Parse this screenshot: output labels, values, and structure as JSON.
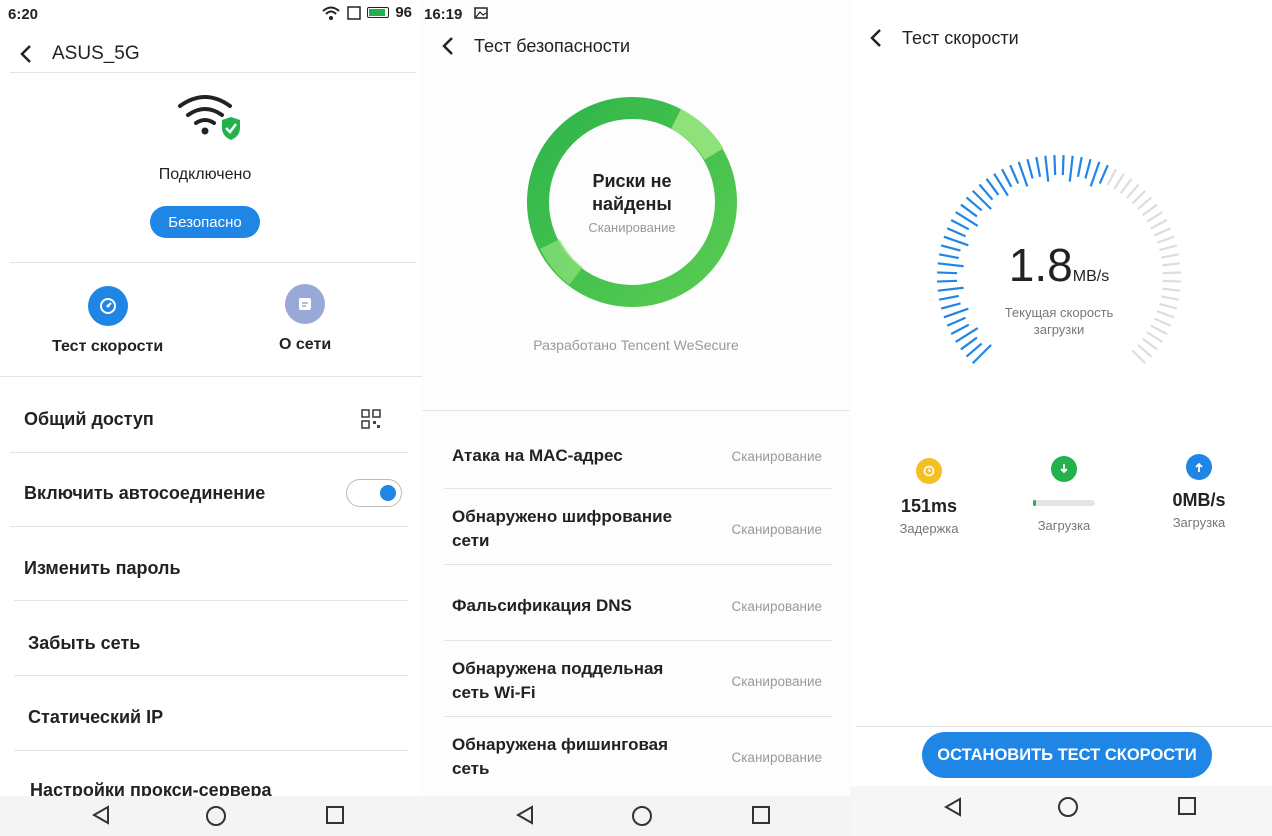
{
  "panel1": {
    "status": {
      "time": "6:20",
      "battery": "96"
    },
    "title": "ASUS_5G",
    "connected": "Подключено",
    "safe_badge": "Безопасно",
    "actions": {
      "speed_test": "Тест скорости",
      "about": "О сети"
    },
    "rows": {
      "share": "Общий доступ",
      "autoconnect": "Включить автосоединение",
      "change_password": "Изменить пароль",
      "forget": "Забыть сеть",
      "static_ip": "Статический IP",
      "proxy": "Настройки прокси-сервера"
    },
    "autoconnect_on": true,
    "colors": {
      "accent": "#1f86e6",
      "green": "#23b14d",
      "about_icon": "#9aa8d8"
    }
  },
  "panel2": {
    "status": {
      "time": "16:19"
    },
    "title": "Тест безопасности",
    "ring_title": "Риски не найдены",
    "ring_sub": "Сканирование",
    "developer": "Разработано Tencent WeSecure",
    "risks": [
      {
        "name": "Атака на MAC-адрес",
        "status": "Сканирование"
      },
      {
        "name": "Обнаружено шифрование сети",
        "status": "Сканирование"
      },
      {
        "name": "Фальсификация DNS",
        "status": "Сканирование"
      },
      {
        "name": "Обнаружена поддельная сеть Wi-Fi",
        "status": "Сканирование"
      },
      {
        "name": "Обнаружена фишинговая сеть",
        "status": "Сканирование"
      }
    ]
  },
  "panel3": {
    "title": "Тест скорости",
    "speed_value": "1.8",
    "speed_unit": "MB/s",
    "speed_caption": "Текущая скорость загрузки",
    "gauge_fraction": 0.6,
    "stats": {
      "latency": {
        "value": "151ms",
        "label": "Задержка"
      },
      "download": {
        "label": "Загрузка",
        "progress": 0.05
      },
      "upload": {
        "value": "0MB/s",
        "label": "Загрузка"
      }
    },
    "stop_button": "ОСТАНОВИТЬ ТЕСТ СКОРОСТИ",
    "colors": {
      "latency": "#f5c122",
      "download": "#23b14d",
      "upload": "#1f86e6"
    }
  }
}
